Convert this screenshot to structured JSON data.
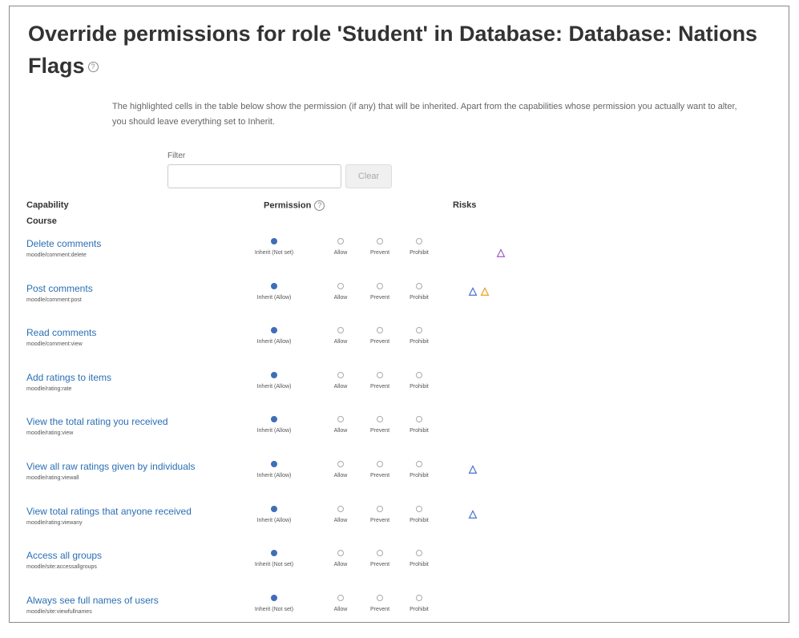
{
  "page": {
    "title": "Override permissions for role 'Student' in Database: Database: Nations Flags",
    "help_icon": "help-icon",
    "intro": "The highlighted cells in the table below show the permission (if any) that will be inherited. Apart from the capabilities whose permission you actually want to alter, you should leave everything set to Inherit.",
    "filter_label": "Filter",
    "filter_value": "",
    "clear_label": "Clear"
  },
  "table": {
    "col_capability": "Capability",
    "col_permission": "Permission",
    "col_risks": "Risks",
    "section": "Course",
    "option_labels": {
      "allow": "Allow",
      "prevent": "Prevent",
      "prohibit": "Prohibit"
    },
    "risk_colors": {
      "purple": "#a05ac8",
      "blue": "#4a6fd4",
      "orange": "#e8a020"
    },
    "rows": [
      {
        "name": "Delete comments",
        "id": "moodle/comment:delete",
        "inherit": "Inherit (Not set)",
        "risks": [
          "purple"
        ]
      },
      {
        "name": "Post comments",
        "id": "moodle/comment:post",
        "inherit": "Inherit (Allow)",
        "risks": [
          "blue",
          "orange"
        ]
      },
      {
        "name": "Read comments",
        "id": "moodle/comment:view",
        "inherit": "Inherit (Allow)",
        "risks": []
      },
      {
        "name": "Add ratings to items",
        "id": "moodle/rating:rate",
        "inherit": "Inherit (Allow)",
        "risks": []
      },
      {
        "name": "View the total rating you received",
        "id": "moodle/rating:view",
        "inherit": "Inherit (Allow)",
        "risks": []
      },
      {
        "name": "View all raw ratings given by individuals",
        "id": "moodle/rating:viewall",
        "inherit": "Inherit (Allow)",
        "risks": [
          "blue"
        ]
      },
      {
        "name": "View total ratings that anyone received",
        "id": "moodle/rating:viewany",
        "inherit": "Inherit (Allow)",
        "risks": [
          "blue"
        ]
      },
      {
        "name": "Access all groups",
        "id": "moodle/site:accessallgroups",
        "inherit": "Inherit (Not set)",
        "risks": []
      },
      {
        "name": "Always see full names of users",
        "id": "moodle/site:viewfullnames",
        "inherit": "Inherit (Not set)",
        "risks": []
      }
    ]
  }
}
